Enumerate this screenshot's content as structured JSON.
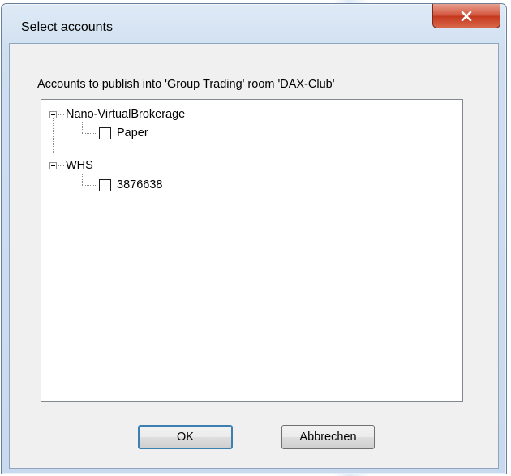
{
  "window": {
    "title": "Select accounts",
    "close_symbol": "x"
  },
  "dialog": {
    "prompt": "Accounts to publish into 'Group Trading' room 'DAX-Club'"
  },
  "tree": [
    {
      "label": "Nano-VirtualBrokerage",
      "expanded": true,
      "children": [
        {
          "label": "Paper",
          "checked": false
        }
      ]
    },
    {
      "label": "WHS",
      "expanded": true,
      "children": [
        {
          "label": "3876638",
          "checked": false
        }
      ]
    }
  ],
  "buttons": {
    "ok": "OK",
    "cancel": "Abbrechen"
  },
  "icons": {
    "close": "close-icon",
    "expander": "collapse-icon"
  }
}
